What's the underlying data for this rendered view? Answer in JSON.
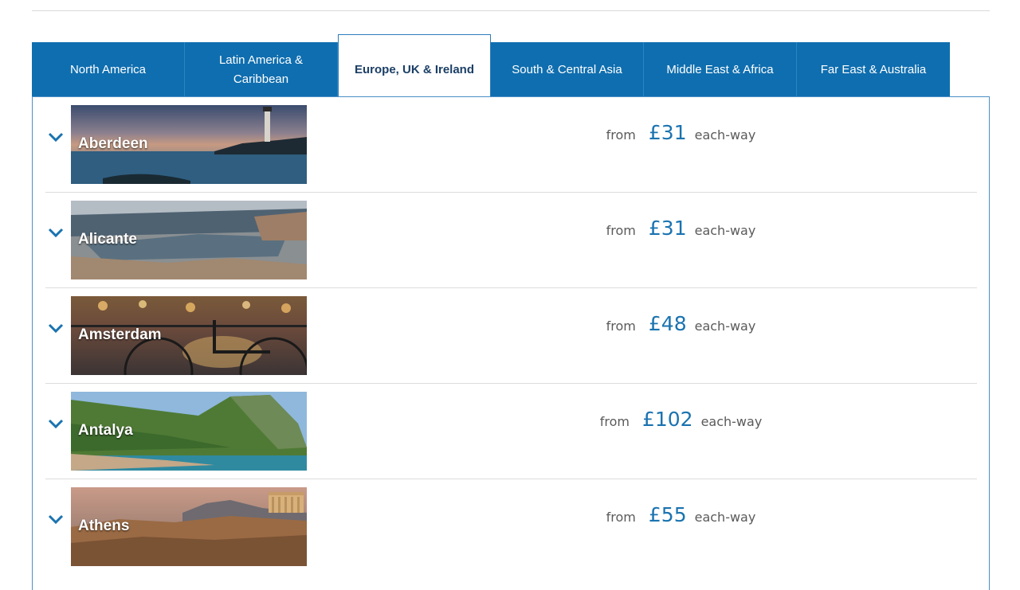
{
  "tabs": [
    {
      "label": "North America"
    },
    {
      "label": "Latin America & Caribbean"
    },
    {
      "label": "Europe, UK & Ireland",
      "active": true
    },
    {
      "label": "South & Central Asia"
    },
    {
      "label": "Middle East & Africa"
    },
    {
      "label": "Far East & Australia"
    }
  ],
  "destinations": [
    {
      "city": "Aberdeen",
      "from_label": "from",
      "price": "£31",
      "suffix": "each-way"
    },
    {
      "city": "Alicante",
      "from_label": "from",
      "price": "£31",
      "suffix": "each-way"
    },
    {
      "city": "Amsterdam",
      "from_label": "from",
      "price": "£48",
      "suffix": "each-way"
    },
    {
      "city": "Antalya",
      "from_label": "from",
      "price": "£102",
      "suffix": "each-way"
    },
    {
      "city": "Athens",
      "from_label": "from",
      "price": "£55",
      "suffix": "each-way"
    }
  ],
  "colors": {
    "tab_bg": "#0f6eaf",
    "price": "#1a73b0",
    "active_tab_text": "#1b3f66"
  },
  "icons": {
    "expand": "chevron-down-icon"
  }
}
